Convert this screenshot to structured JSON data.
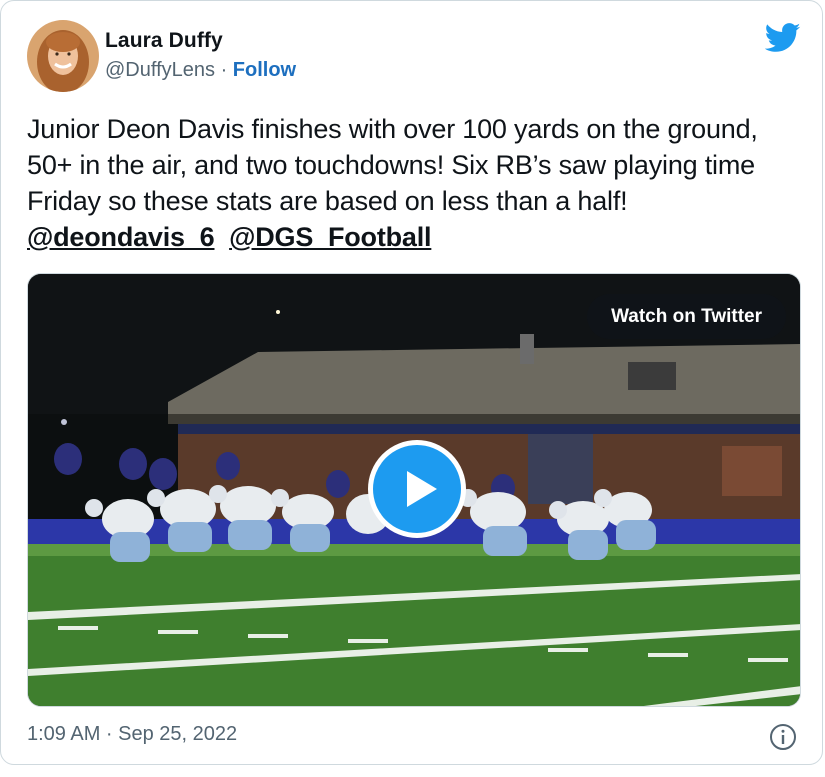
{
  "author": {
    "name": "Laura Duffy",
    "handle": "@DuffyLens",
    "separator": "·",
    "follow_label": "Follow"
  },
  "tweet": {
    "text_main": "Junior Deon Davis finishes with over 100 yards on the ground, 50+ in the air,  and two touchdowns! Six RB’s saw playing time Friday so these stats are based on less than a half! ",
    "mentions": [
      "@deondavis_6",
      "@DGS_Football"
    ]
  },
  "media": {
    "watch_label": "Watch on Twitter",
    "play_icon": "play-icon"
  },
  "footer": {
    "timestamp": "1:09 AM · Sep 25, 2022",
    "info_icon": "info-icon"
  },
  "colors": {
    "accent": "#1d9bf0",
    "follow": "#1d6fbf",
    "muted": "#536471",
    "field_green": "#3f7f2e",
    "field_blue": "#2c37a8"
  }
}
